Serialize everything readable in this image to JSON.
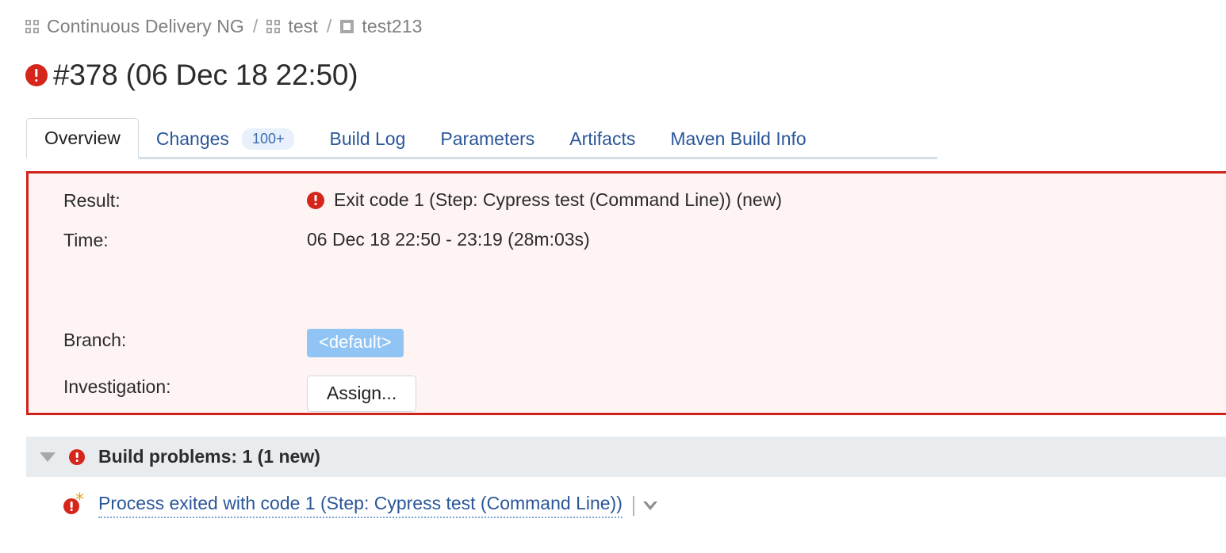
{
  "breadcrumb": {
    "items": [
      {
        "label": "Continuous Delivery NG",
        "icon": "project-icon"
      },
      {
        "label": "test",
        "icon": "project-icon"
      },
      {
        "label": "test213",
        "icon": "buildtype-icon"
      }
    ],
    "separator": "/"
  },
  "header": {
    "status_icon": "error-icon",
    "title": "#378 (06 Dec 18 22:50)"
  },
  "tabs": [
    {
      "label": "Overview",
      "active": true,
      "badge": null
    },
    {
      "label": "Changes",
      "active": false,
      "badge": "100+"
    },
    {
      "label": "Build Log",
      "active": false,
      "badge": null
    },
    {
      "label": "Parameters",
      "active": false,
      "badge": null
    },
    {
      "label": "Artifacts",
      "active": false,
      "badge": null
    },
    {
      "label": "Maven Build Info",
      "active": false,
      "badge": null
    }
  ],
  "result_panel": {
    "border_color": "#d0241b",
    "background_color": "#fdf4f3",
    "result": {
      "label": "Result:",
      "icon": "error-icon",
      "text": "Exit code 1 (Step: Cypress test (Command Line)) (new)"
    },
    "time": {
      "label": "Time:",
      "text": "06 Dec 18 22:50 - 23:19 (28m:03s)"
    },
    "branch": {
      "label": "Branch:",
      "value": "<default>",
      "pill_color": "#8fc4f5"
    },
    "investigation": {
      "label": "Investigation:",
      "button_label": "Assign..."
    }
  },
  "build_problems": {
    "header": {
      "twisty": "chevron-down-icon",
      "icon": "error-icon",
      "text": "Build problems: 1 (1 new)"
    },
    "items": [
      {
        "icon": "error-icon",
        "new_marker": "*",
        "link_text": "Process exited with code 1 (Step: Cypress test (Command Line))",
        "menu_icon": "caret-down-icon"
      }
    ]
  }
}
